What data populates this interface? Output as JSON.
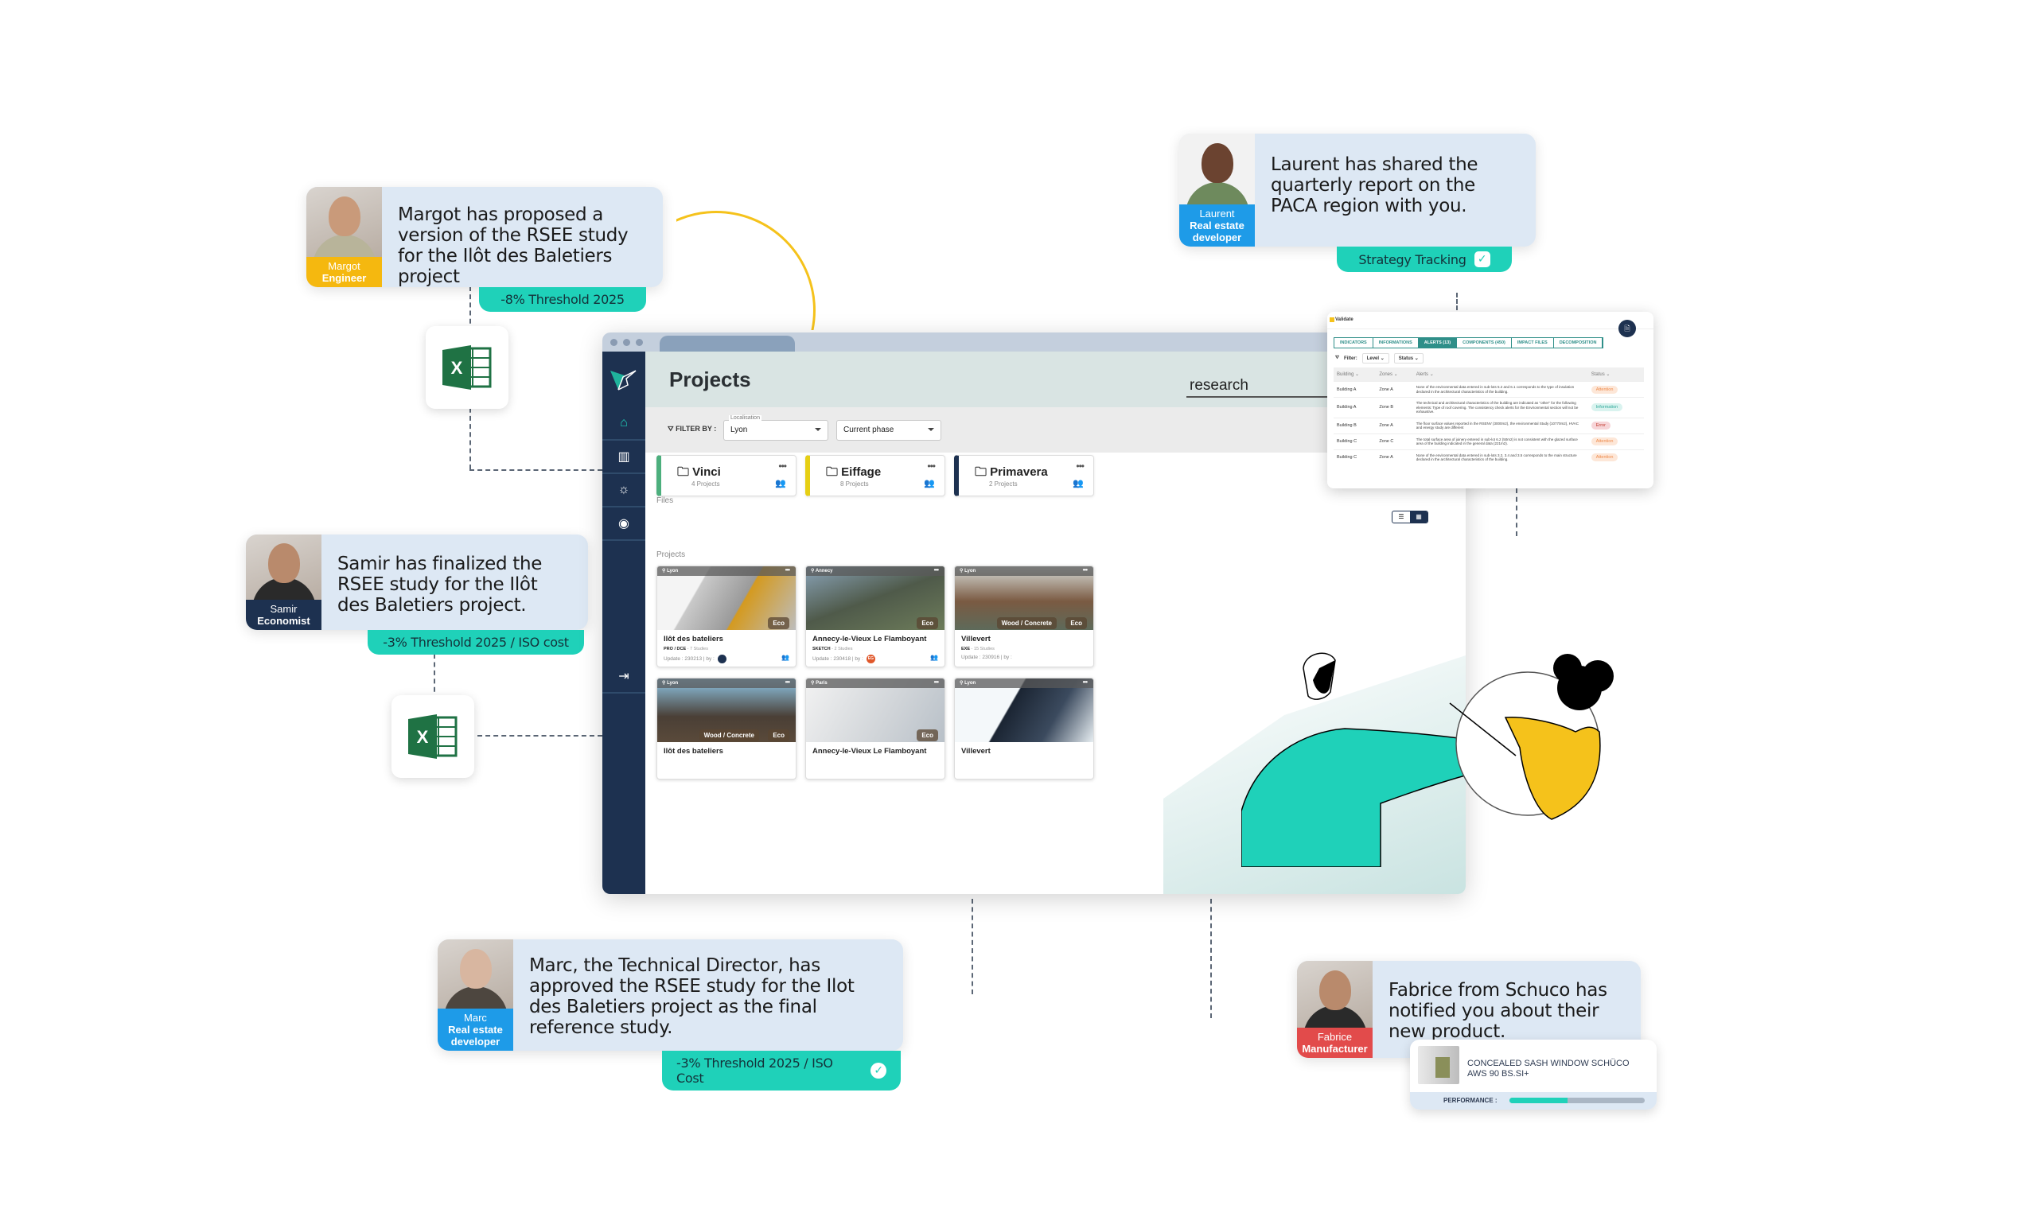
{
  "notifications": [
    {
      "id": "margot",
      "name": "Margot",
      "role": "Engineer",
      "role_color": "#f5b80f",
      "message": "Margot has proposed a version of the RSEE study for the Ilôt des Baletiers project",
      "tag": "-8% Threshold 2025",
      "tag_check": false
    },
    {
      "id": "laurent",
      "name": "Laurent",
      "role": "Real estate developer",
      "role_color": "#1e9be8",
      "message": "Laurent has shared the quarterly report on the PACA region with you.",
      "tag": "Strategy Tracking",
      "tag_check": true
    },
    {
      "id": "samir",
      "name": "Samir",
      "role": "Economist",
      "role_color": "#1d3150",
      "message": "Samir has finalized the RSEE study for the Ilôt des Baletiers project.",
      "tag": "-3% Threshold 2025 / ISO cost",
      "tag_check": false
    },
    {
      "id": "marc",
      "name": "Marc",
      "role": "Real estate developer",
      "role_color": "#1e9be8",
      "message": "Marc, the Technical Director, has approved the RSEE study for the Ilot des Baletiers project as the final reference study.",
      "tag": "-3% Threshold 2025 / ISO Cost",
      "tag_check": true
    },
    {
      "id": "fabrice",
      "name": "Fabrice",
      "role": "Manufacturer",
      "role_color": "#e24b4b",
      "message": "Fabrice from Schuco has notified you about their new product.",
      "tag": "",
      "tag_check": false
    }
  ],
  "excel_icons": [
    {
      "name": "excel-file-icon",
      "letter": "X"
    },
    {
      "name": "excel-file-icon",
      "letter": "X"
    }
  ],
  "app": {
    "title": "Projects",
    "search_value": "research",
    "filter_label": "FILTER BY :",
    "localisation_label": "Localisation",
    "localisation_value": "Lyon",
    "phase_value": "Current phase",
    "files_label": "Files",
    "projects_label": "Projects",
    "sidebar": [
      {
        "icon": "home-icon",
        "glyph": "⌂",
        "active": true
      },
      {
        "icon": "library-icon",
        "glyph": "▥",
        "active": false
      },
      {
        "icon": "lightbulb-icon",
        "glyph": "☼",
        "active": false
      },
      {
        "icon": "user-circle-icon",
        "glyph": "◉",
        "active": false
      },
      {
        "icon": "logout-icon",
        "glyph": "⇥",
        "active": false
      }
    ],
    "folders": [
      {
        "name": "Vinci",
        "count": "4 Projects",
        "color": "#4caf7d"
      },
      {
        "name": "Eiffage",
        "count": "8 Projects",
        "color": "#e6cf14"
      },
      {
        "name": "Primavera",
        "count": "2 Projects",
        "color": "#1d3150"
      }
    ],
    "projects": [
      {
        "location": "Lyon",
        "title": "Ilôt des bateliers",
        "phase": "PRO / DCE",
        "studies": "7 Studies",
        "update": "Update : 230213 | by :",
        "avatar": "",
        "avatar_color": "#1d3150",
        "badges": [
          "Eco"
        ]
      },
      {
        "location": "Annecy",
        "title": "Annecy-le-Vieux Le Flamboyant",
        "phase": "SKETCH",
        "studies": "2 Studies",
        "update": "Update : 230418 | by :",
        "avatar": "EG",
        "avatar_color": "#e0572a",
        "badges": [
          "Eco"
        ]
      },
      {
        "location": "Lyon",
        "title": "Villevert",
        "phase": "EXE",
        "studies": "15 Studies",
        "update": "Update : 230916 | by :",
        "avatar": "",
        "avatar_color": "#1d3150",
        "badges": [
          "Wood / Concrete",
          "Eco"
        ]
      },
      {
        "location": "Lyon",
        "title": "Ilôt des bateliers",
        "phase": "",
        "studies": "",
        "update": "",
        "avatar": "",
        "avatar_color": "",
        "badges": [
          "Wood / Concrete",
          "Eco"
        ]
      },
      {
        "location": "Paris",
        "title": "Annecy-le-Vieux Le Flamboyant",
        "phase": "",
        "studies": "",
        "update": "",
        "avatar": "",
        "avatar_color": "",
        "badges": [
          "Eco"
        ]
      },
      {
        "location": "Lyon",
        "title": "Villevert",
        "phase": "",
        "studies": "",
        "update": "",
        "avatar": "",
        "avatar_color": "",
        "badges": []
      }
    ]
  },
  "alerts_panel": {
    "title": "Validate",
    "tabs": [
      "INDICATORS",
      "INFORMATIONS",
      "ALERTS (13)",
      "COMPONENTS (450)",
      "IMPACT FILES",
      "DECOMPOSITION"
    ],
    "active_tab": 2,
    "filter_label": "Filter:",
    "filters": [
      "Level",
      "Status"
    ],
    "columns": [
      "Building ⌄",
      "Zones ⌄",
      "Alerts ⌄",
      "Status ⌄"
    ],
    "rows": [
      {
        "building": "Building A",
        "zone": "Zone A",
        "alert": "None of the environmental data entered in sub-lots 5.2 and 6.1 corresponds to the type of insulation declared in the architectural characteristics of the building.",
        "status": "Attention"
      },
      {
        "building": "Building A",
        "zone": "Zone B",
        "alert": "The technical and architectural characteristics of the building are indicated as \"other\" for the following elements: Type of roof covering. The consistency check alerts for the Environmental section will not be exhaustive.",
        "status": "Information"
      },
      {
        "building": "Building B",
        "zone": "Zone A",
        "alert": "The floor surface values reported in the RSENV (3000m2), the environmental Study (10770m2), HVAC and energy study are different",
        "status": "Error"
      },
      {
        "building": "Building C",
        "zone": "Zone C",
        "alert": "The total surface area of joinery entered in sub-lot 6.2 (50m2) is not consistent with the glazed surface area of the building indicated in the general data (221m2).",
        "status": "Attention"
      },
      {
        "building": "Building C",
        "zone": "Zone A",
        "alert": "None of the environmental data entered in sub-lots 3.2, 3.4 and 3.5 corresponds to the main structure declared in the architectural characteristics of the building.",
        "status": "Attention"
      }
    ]
  },
  "product": {
    "name": "CONCEALED SASH WINDOW SCHÜCO AWS 90 BS.SI+",
    "performance_label": "PERFORMANCE :",
    "performance": 0.43
  }
}
